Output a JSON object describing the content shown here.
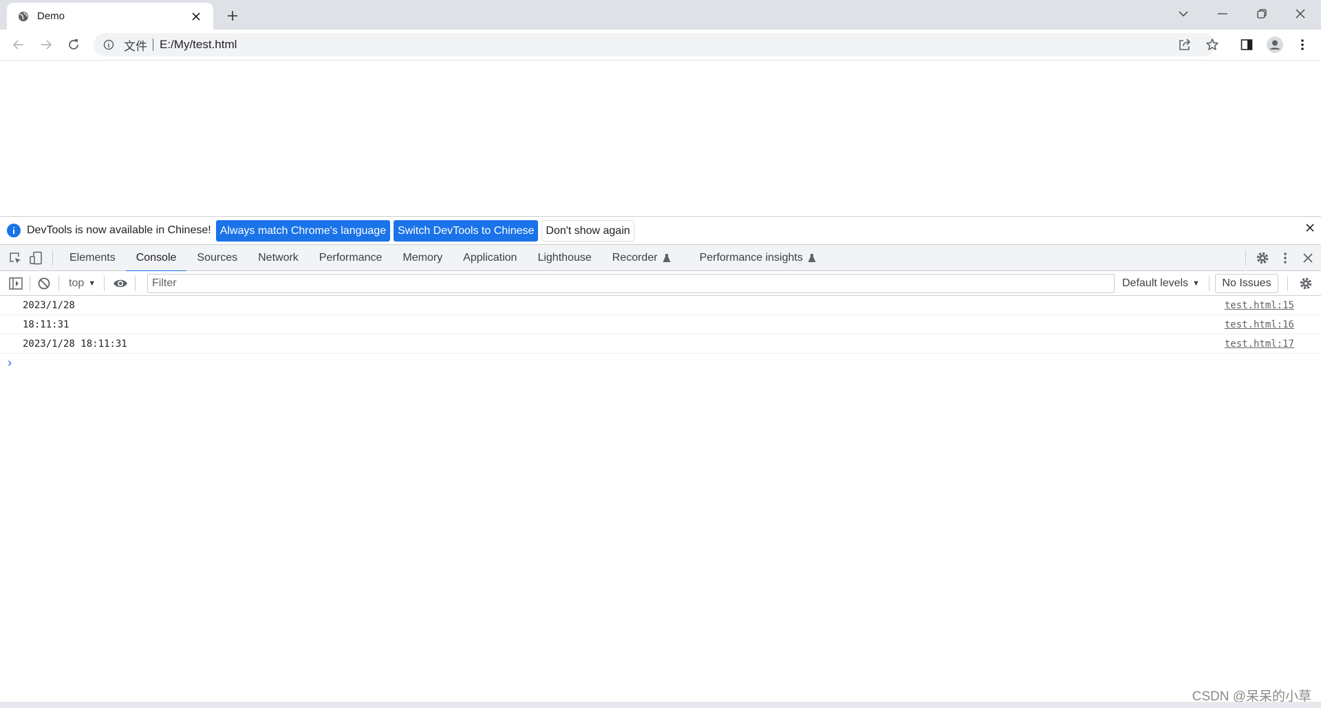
{
  "browser": {
    "tab_title": "Demo",
    "scheme_label": "文件",
    "url": "E:/My/test.html"
  },
  "infobar": {
    "message": "DevTools is now available in Chinese!",
    "btn_match": "Always match Chrome's language",
    "btn_switch": "Switch DevTools to Chinese",
    "btn_dismiss": "Don't show again"
  },
  "devtools": {
    "tabs": [
      "Elements",
      "Console",
      "Sources",
      "Network",
      "Performance",
      "Memory",
      "Application",
      "Lighthouse",
      "Recorder",
      "Performance insights"
    ],
    "active_tab": "Console"
  },
  "console": {
    "context": "top",
    "filter_placeholder": "Filter",
    "levels": "Default levels",
    "issues": "No Issues",
    "logs": [
      {
        "text": "2023/1/28",
        "source": "test.html:15"
      },
      {
        "text": "18:11:31",
        "source": "test.html:16"
      },
      {
        "text": "2023/1/28 18:11:31",
        "source": "test.html:17"
      }
    ],
    "prompt_symbol": "›"
  },
  "watermark": "CSDN @呆呆的小草",
  "colors": {
    "accent": "#1a73e8",
    "tabstrip": "#dee1e6",
    "devtools_bar": "#f1f3f4"
  }
}
